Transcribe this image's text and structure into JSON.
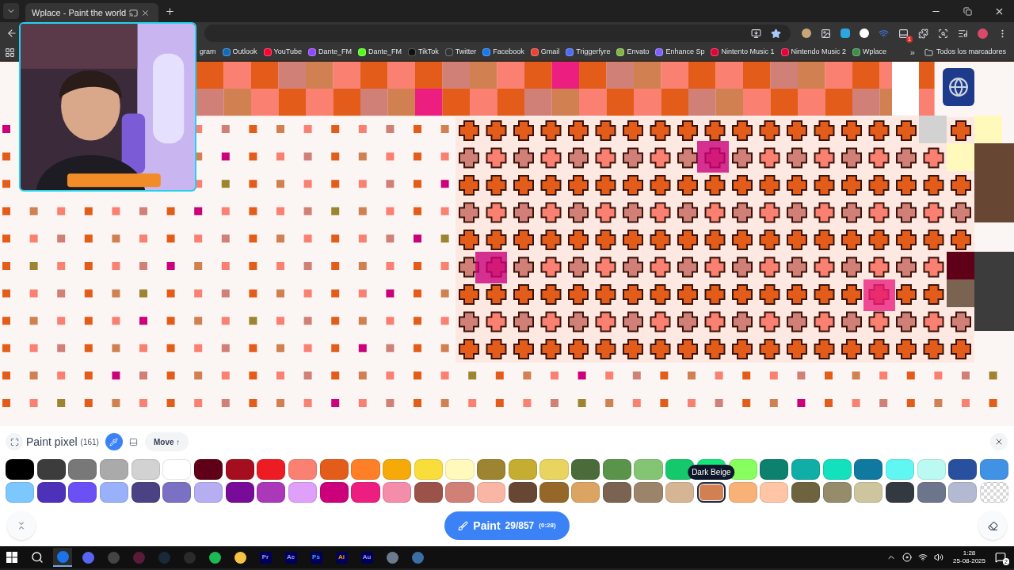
{
  "browser": {
    "tab": {
      "title": "Wplace - Paint the world"
    },
    "extension_badge": "1",
    "bookmarks": [
      {
        "label": "gram"
      },
      {
        "label": "Outlook",
        "color": "#0f6cbd"
      },
      {
        "label": "YouTube",
        "color": "#ff0033"
      },
      {
        "label": "Dante_FM",
        "color": "#9146ff"
      },
      {
        "label": "Dante_FM",
        "color": "#53fc18"
      },
      {
        "label": "TikTok",
        "color": "#111111"
      },
      {
        "label": "Twitter",
        "color": "#333333"
      },
      {
        "label": "Facebook",
        "color": "#1877f2"
      },
      {
        "label": "Gmail",
        "color": "#ea4335"
      },
      {
        "label": "Triggerfyre",
        "color": "#4a6cf7"
      },
      {
        "label": "Envato",
        "color": "#82b541"
      },
      {
        "label": "Enhance Sp",
        "color": "#7b61ff"
      },
      {
        "label": "Nintento Music 1",
        "color": "#e60039"
      },
      {
        "label": "Nintendo Music 2",
        "color": "#e60039"
      },
      {
        "label": "Wplace",
        "color": "#3d8f4a"
      }
    ],
    "overflow": "»",
    "all_bookmarks": "Todos los marcadores"
  },
  "tool": {
    "title": "Paint pixel",
    "count": "(161)",
    "move": "Move ↑"
  },
  "palette": {
    "tooltip": "Dark Beige",
    "swatches": [
      {
        "kind": "solid",
        "color": "#000000",
        "selected": false
      },
      {
        "kind": "solid",
        "color": "#3c3c3c",
        "selected": false
      },
      {
        "kind": "solid",
        "color": "#787878",
        "selected": false
      },
      {
        "kind": "solid",
        "color": "#aaaaaa",
        "selected": false
      },
      {
        "kind": "solid",
        "color": "#d2d2d2",
        "selected": false
      },
      {
        "kind": "solid",
        "color": "#ffffff",
        "selected": false
      },
      {
        "kind": "solid",
        "color": "#600018",
        "selected": false
      },
      {
        "kind": "solid",
        "color": "#a50e1e",
        "selected": false
      },
      {
        "kind": "solid",
        "color": "#ed1c24",
        "selected": false
      },
      {
        "kind": "solid",
        "color": "#fa8072",
        "selected": false
      },
      {
        "kind": "solid",
        "color": "#e45c1a",
        "selected": false
      },
      {
        "kind": "solid",
        "color": "#ff7f27",
        "selected": false
      },
      {
        "kind": "solid",
        "color": "#f6aa09",
        "selected": false
      },
      {
        "kind": "solid",
        "color": "#f9dd3b",
        "selected": false
      },
      {
        "kind": "solid",
        "color": "#fffabc",
        "selected": false
      },
      {
        "kind": "solid",
        "color": "#9c8431",
        "selected": false
      },
      {
        "kind": "solid",
        "color": "#c5ad31",
        "selected": false
      },
      {
        "kind": "solid",
        "color": "#e8d45f",
        "selected": false
      },
      {
        "kind": "solid",
        "color": "#4a6b3a",
        "selected": false
      },
      {
        "kind": "solid",
        "color": "#5a944a",
        "selected": false
      },
      {
        "kind": "solid",
        "color": "#84c573",
        "selected": false
      },
      {
        "kind": "solid",
        "color": "#13c96b",
        "selected": false
      },
      {
        "kind": "solid",
        "color": "#13e67b",
        "selected": false
      },
      {
        "kind": "solid",
        "color": "#87ff5e",
        "selected": false
      },
      {
        "kind": "solid",
        "color": "#0c816e",
        "selected": false
      },
      {
        "kind": "solid",
        "color": "#10aea6",
        "selected": false
      },
      {
        "kind": "solid",
        "color": "#13e1be",
        "selected": false
      },
      {
        "kind": "solid",
        "color": "#0f799f",
        "selected": false
      },
      {
        "kind": "solid",
        "color": "#60f7f2",
        "selected": false
      },
      {
        "kind": "solid",
        "color": "#bbfaf2",
        "selected": false
      },
      {
        "kind": "solid",
        "color": "#28509e",
        "selected": false
      },
      {
        "kind": "solid",
        "color": "#4093e4",
        "selected": false
      },
      {
        "kind": "solid",
        "color": "#7dc7ff",
        "selected": false
      },
      {
        "kind": "solid",
        "color": "#4d31b8",
        "selected": false
      },
      {
        "kind": "solid",
        "color": "#6b50f6",
        "selected": false
      },
      {
        "kind": "solid",
        "color": "#99b1fb",
        "selected": false
      },
      {
        "kind": "solid",
        "color": "#4a4284",
        "selected": false
      },
      {
        "kind": "solid",
        "color": "#7a71c4",
        "selected": false
      },
      {
        "kind": "solid",
        "color": "#b5aef1",
        "selected": false
      },
      {
        "kind": "solid",
        "color": "#780c99",
        "selected": false
      },
      {
        "kind": "solid",
        "color": "#aa38b9",
        "selected": false
      },
      {
        "kind": "solid",
        "color": "#e09ff9",
        "selected": false
      },
      {
        "kind": "solid",
        "color": "#cb007a",
        "selected": false
      },
      {
        "kind": "solid",
        "color": "#ec1f80",
        "selected": false
      },
      {
        "kind": "solid",
        "color": "#f38da9",
        "selected": false
      },
      {
        "kind": "solid",
        "color": "#9b5249",
        "selected": false
      },
      {
        "kind": "solid",
        "color": "#d18078",
        "selected": false
      },
      {
        "kind": "solid",
        "color": "#fab6a4",
        "selected": false
      },
      {
        "kind": "solid",
        "color": "#684634",
        "selected": false
      },
      {
        "kind": "solid",
        "color": "#95682a",
        "selected": false
      },
      {
        "kind": "solid",
        "color": "#dba463",
        "selected": false
      },
      {
        "kind": "solid",
        "color": "#7b6352",
        "selected": false
      },
      {
        "kind": "solid",
        "color": "#9c846b",
        "selected": false
      },
      {
        "kind": "solid",
        "color": "#d6b594",
        "selected": false
      },
      {
        "kind": "solid",
        "color": "#d18051",
        "selected": true
      },
      {
        "kind": "solid",
        "color": "#f8b277",
        "selected": false
      },
      {
        "kind": "solid",
        "color": "#ffc5a5",
        "selected": false
      },
      {
        "kind": "solid",
        "color": "#6d643f",
        "selected": false
      },
      {
        "kind": "solid",
        "color": "#948c6b",
        "selected": false
      },
      {
        "kind": "solid",
        "color": "#cdc59e",
        "selected": false
      },
      {
        "kind": "solid",
        "color": "#333941",
        "selected": false
      },
      {
        "kind": "solid",
        "color": "#6d758d",
        "selected": false
      },
      {
        "kind": "solid",
        "color": "#b3b9d1",
        "selected": false
      },
      {
        "kind": "transparent",
        "selected": false
      }
    ]
  },
  "paint_button": {
    "label": "Paint",
    "count": "29/857",
    "timer": "(0:28)"
  },
  "taskbar": {
    "apps": [
      {
        "kind": "icon",
        "color": "#1a73e8",
        "selected": true
      },
      {
        "kind": "icon",
        "color": "#5865f2",
        "selected": false
      },
      {
        "kind": "icon",
        "color": "#444444",
        "selected": false
      },
      {
        "kind": "icon",
        "color": "#5a1a3a",
        "selected": false
      },
      {
        "kind": "icon",
        "color": "#1b2838",
        "selected": false
      },
      {
        "kind": "icon",
        "color": "#2a2a2a",
        "selected": false
      },
      {
        "kind": "icon",
        "color": "#1db954",
        "selected": false
      },
      {
        "kind": "icon",
        "color": "#f5c542",
        "selected": false
      },
      {
        "kind": "text",
        "label": "Pr",
        "color": "#9999ff",
        "selected": false
      },
      {
        "kind": "text",
        "label": "Ae",
        "color": "#9999ff",
        "selected": false
      },
      {
        "kind": "text",
        "label": "Ps",
        "color": "#31a8ff",
        "selected": false
      },
      {
        "kind": "text",
        "label": "Ai",
        "color": "#ff9a00",
        "selected": false
      },
      {
        "kind": "text",
        "label": "Au",
        "color": "#9999ff",
        "selected": false
      },
      {
        "kind": "icon",
        "color": "#6b7b8c",
        "selected": false
      },
      {
        "kind": "icon",
        "color": "#3a6ea5",
        "selected": false
      }
    ],
    "time": "1:28",
    "date": "25-08-2025",
    "notifications": "2"
  }
}
